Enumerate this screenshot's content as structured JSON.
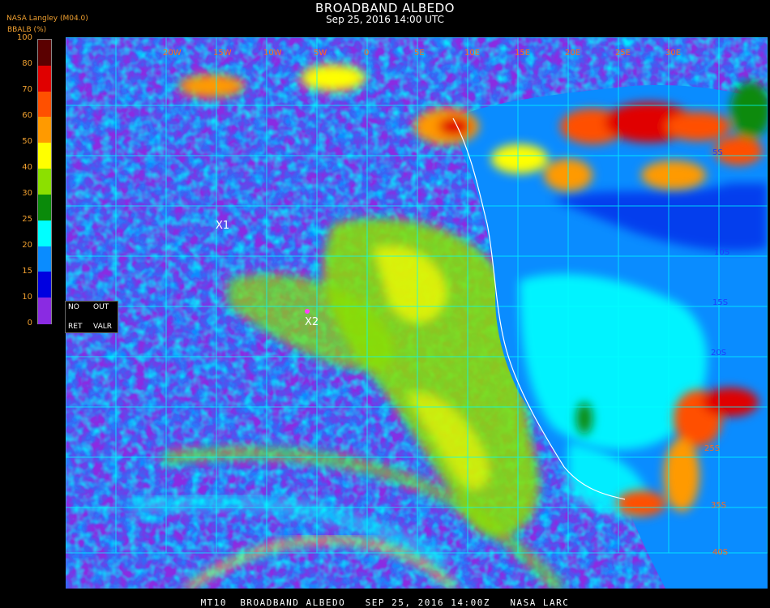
{
  "header": {
    "title": "BROADBAND ALBEDO",
    "subtitle": "Sep 25, 2016 14:00 UTC",
    "source": "NASA Langley (M04.0)",
    "units": "BBALB (%)"
  },
  "colorbar": {
    "ticks": [
      "100",
      "80",
      "70",
      "60",
      "50",
      "40",
      "30",
      "25",
      "20",
      "15",
      "10",
      "0"
    ],
    "colors": [
      "#5a0000",
      "#e00000",
      "#ff5000",
      "#ff9a00",
      "#ffff00",
      "#8ce000",
      "#0a8a0a",
      "#00ffff",
      "#0a8cff",
      "#0000e0",
      "#8a2be2"
    ]
  },
  "legend_box": {
    "no": "NO",
    "out": "OUT",
    "ret": "RET",
    "valr": "VALR"
  },
  "map": {
    "markers": [
      {
        "label": "X1"
      },
      {
        "label": "X2"
      }
    ],
    "lon_labels": [
      "20W",
      "15W",
      "10W",
      "5W",
      "0",
      "5E",
      "10E",
      "15E",
      "20E",
      "25E",
      "30E"
    ],
    "lat_labels": [
      "5S",
      "10S",
      "15S",
      "20S",
      "25S",
      "35S",
      "40S"
    ]
  },
  "footer": {
    "text": "MT10  BROADBAND ALBEDO   SEP 25, 2016 14:00Z   NASA LARC"
  }
}
